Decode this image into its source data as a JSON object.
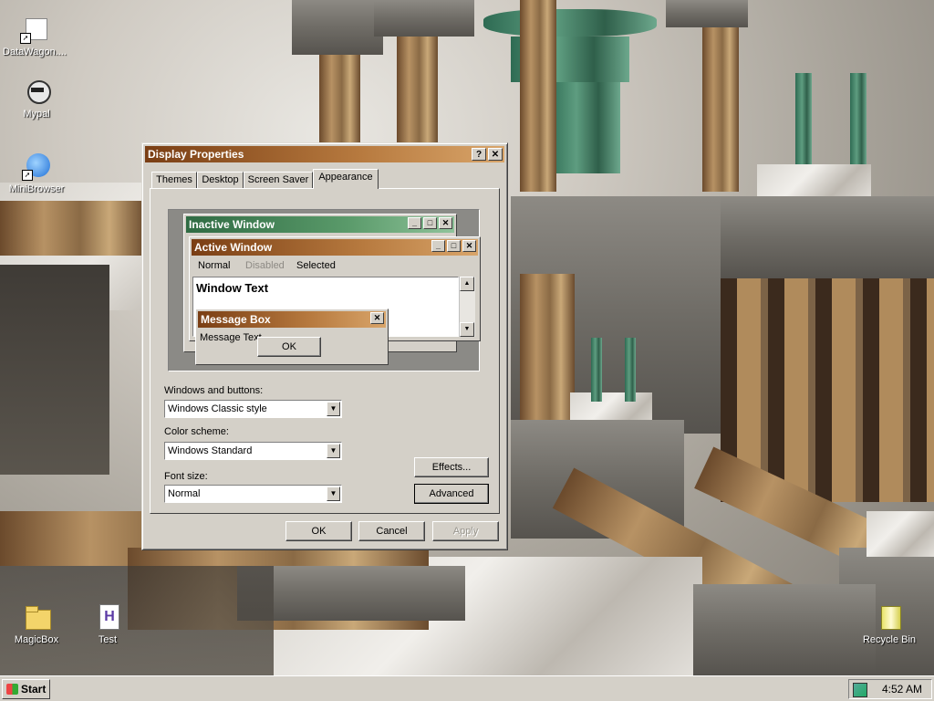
{
  "desktop": {
    "icons": [
      {
        "label": "DataWagon...."
      },
      {
        "label": "Mypal"
      },
      {
        "label": "MiniBrowser"
      },
      {
        "label": "MagicBox"
      },
      {
        "label": "Test"
      },
      {
        "label": "Recycle Bin"
      }
    ]
  },
  "dialog": {
    "title": "Display Properties",
    "help_glyph": "?",
    "close_glyph": "✕",
    "tabs": [
      {
        "label": "Themes"
      },
      {
        "label": "Desktop"
      },
      {
        "label": "Screen Saver"
      },
      {
        "label": "Appearance",
        "active": true
      }
    ],
    "preview": {
      "inactive_title": "Inactive Window",
      "active_title": "Active Window",
      "menu": {
        "normal": "Normal",
        "disabled": "Disabled",
        "selected": "Selected"
      },
      "window_text": "Window Text",
      "message_box_title": "Message Box",
      "message_text": "Message Text",
      "ok_label": "OK"
    },
    "windows_and_buttons": {
      "label": "Windows and buttons:",
      "value": "Windows Classic style"
    },
    "color_scheme": {
      "label": "Color scheme:",
      "value": "Windows Standard"
    },
    "font_size": {
      "label": "Font size:",
      "value": "Normal"
    },
    "effects_label": "Effects...",
    "advanced_label": "Advanced",
    "ok_label": "OK",
    "cancel_label": "Cancel",
    "apply_label": "Apply"
  },
  "taskbar": {
    "start_label": "Start",
    "clock": "4:52 AM"
  },
  "colors": {
    "active_title": "#b77a3f",
    "inactive_title": "#3f7a52",
    "face": "#d4d0c8"
  }
}
